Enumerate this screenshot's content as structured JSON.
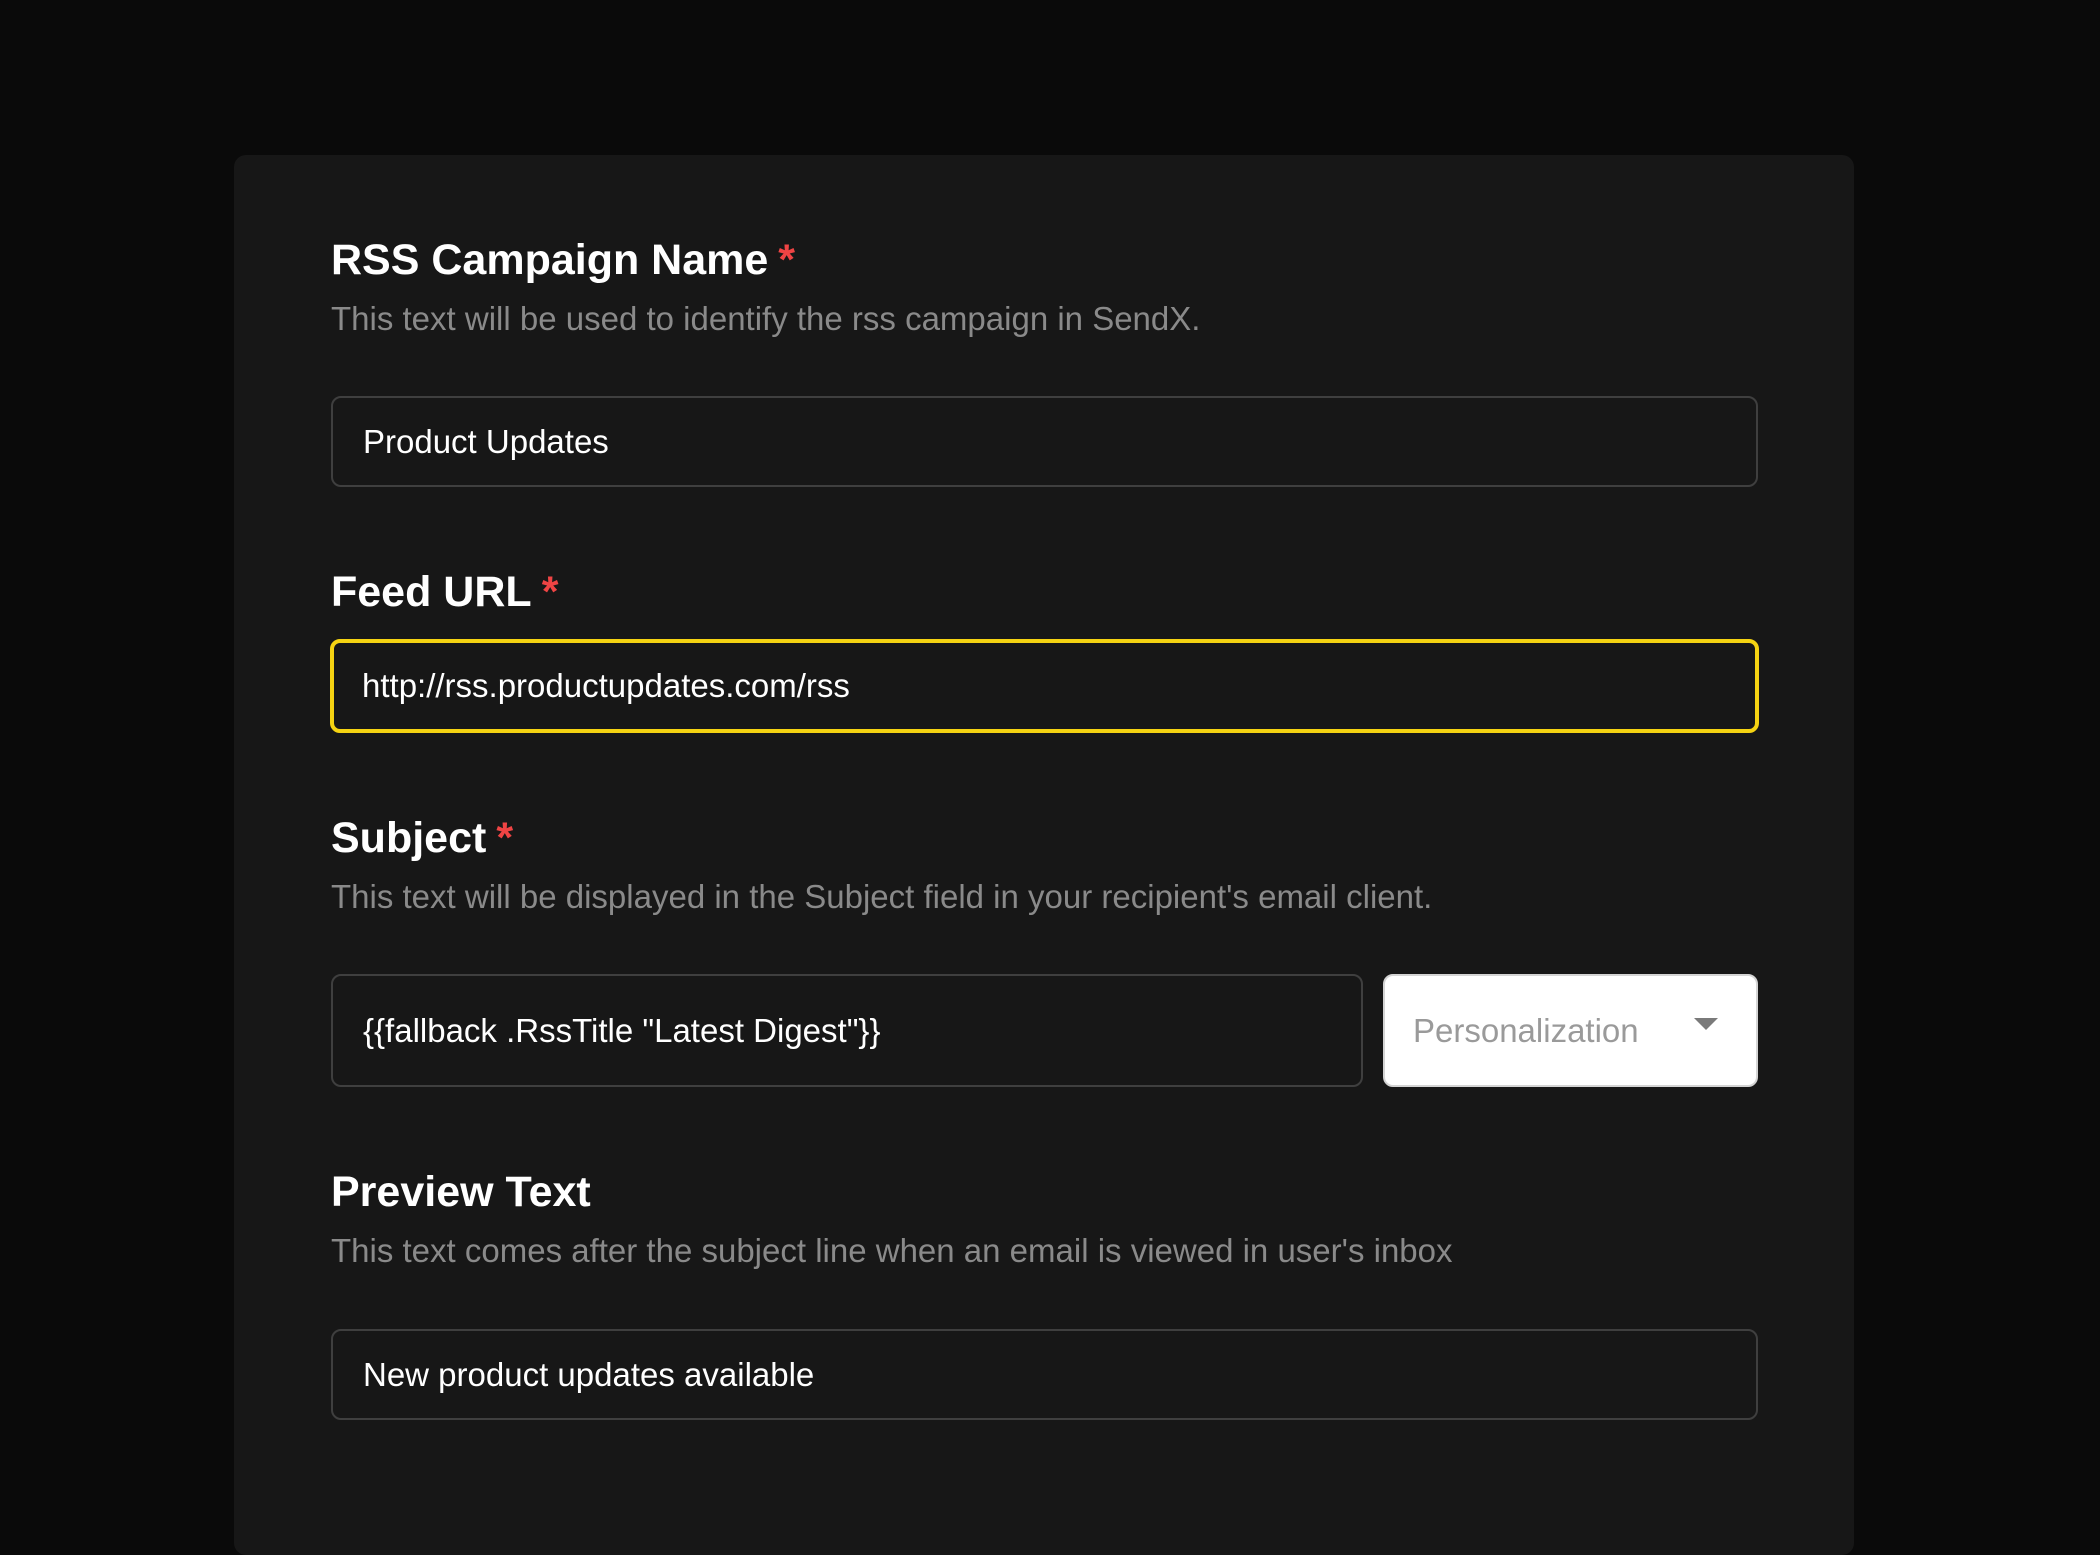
{
  "form": {
    "campaign_name": {
      "label": "RSS Campaign Name",
      "required_mark": "*",
      "description": "This text will be used to identify the rss campaign in SendX.",
      "value": "Product Updates"
    },
    "feed_url": {
      "label": "Feed URL",
      "required_mark": "*",
      "value": "http://rss.productupdates.com/rss"
    },
    "subject": {
      "label": "Subject",
      "required_mark": "*",
      "description": "This text will be displayed in the Subject field in your recipient's email client.",
      "value": "{{fallback .RssTitle \"Latest Digest\"}}",
      "personalization_placeholder": "Personalization"
    },
    "preview_text": {
      "label": "Preview Text",
      "description": "This text comes after the subject line when an email is viewed in user's inbox",
      "value": "New product updates available"
    }
  },
  "colors": {
    "background": "#0a0a0a",
    "card": "#171717",
    "required": "#ef4444",
    "focus_border": "#f5d312",
    "description_text": "#8a8a8a"
  },
  "icons": {
    "dropdown": "chevron-down-icon"
  }
}
